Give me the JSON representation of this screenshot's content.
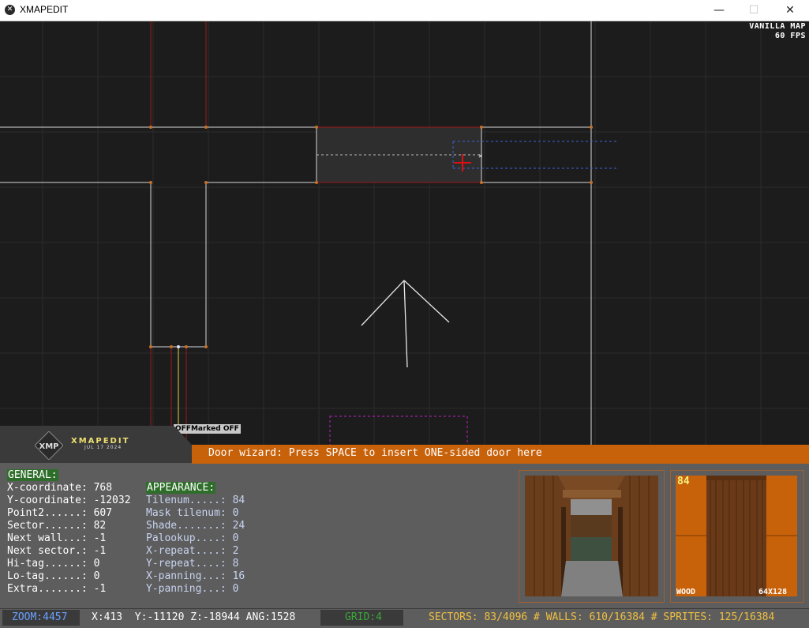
{
  "window": {
    "title": "XMAPEDIT",
    "minimize_glyph": "—",
    "maximize_glyph": "☐",
    "close_glyph": "✕"
  },
  "map_info": {
    "map_type": "VANILLA MAP",
    "fps": "60 FPS"
  },
  "marked_label": "OFFMarked OFF",
  "logo": {
    "badge_text": "XMP",
    "name": "XMAPEDIT",
    "date": "JUL 17 2024"
  },
  "message": "Door wizard: Press SPACE to insert ONE-sided door here",
  "general": {
    "title": "GENERAL:",
    "fields": [
      "X-coordinate: 768",
      "Y-coordinate: -12032",
      "Point2......: 607",
      "Sector......: 82",
      "Next wall...: -1",
      "Next sector.: -1",
      "Hi-tag......: 0",
      "Lo-tag......: 0",
      "Extra.......: -1"
    ]
  },
  "appearance": {
    "title": "APPEARANCE:",
    "fields": [
      "Tilenum.....: 84",
      "Mask tilenum: 0",
      "Shade.......: 24",
      "Palookup....: 0",
      "X-repeat....: 2",
      "Y-repeat....: 8",
      "X-panning...: 16",
      "Y-panning...: 0"
    ]
  },
  "tile": {
    "number": "84",
    "name": "WOOD",
    "size": "64X128"
  },
  "status": {
    "zoom": "ZOOM:4457",
    "coords": "X:413  Y:-11120 Z:-18944 ANG:1528",
    "grid": "GRID:4",
    "counts": "SECTORS: 83/4096 # WALLS: 610/16384 # SPRITES: 125/16384"
  },
  "colors": {
    "accent_orange": "#c8620a",
    "panel_gray": "#5d5d5d",
    "section_green": "#2e6e2a",
    "zoom_blue": "#6aa0ff",
    "grid_green": "#3aa83a",
    "status_amber": "#f0c040"
  }
}
